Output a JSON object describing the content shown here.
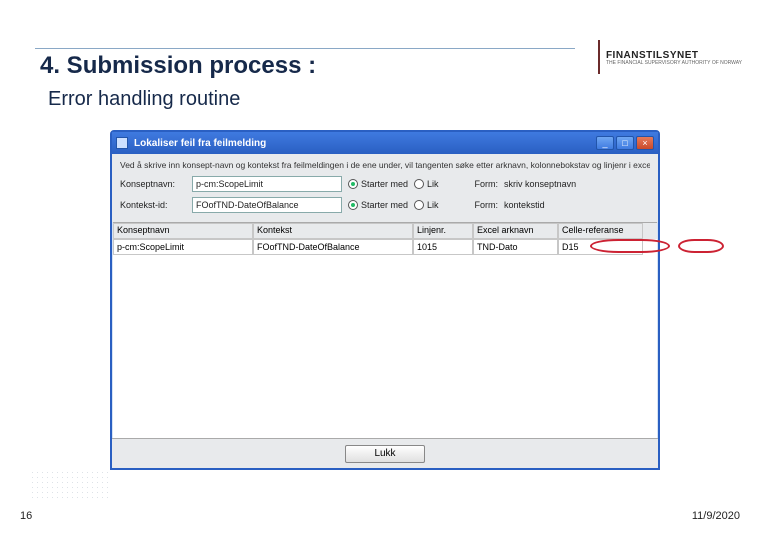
{
  "slide": {
    "title": "4. Submission process :",
    "subtitle": "Error handling routine",
    "page_number": "16",
    "date": "11/9/2020"
  },
  "logo": {
    "name": "FINANSTILSYNET",
    "tagline": "THE FINANCIAL SUPERVISORY AUTHORITY OF NORWAY"
  },
  "window": {
    "title": "Lokaliser feil fra feilmelding",
    "hint": "Ved å skrive inn konsept-navn og kontekst fra feilmeldingen i de ene under, vil tangenten søke etter arknavn, kolonnebokstav og linjenr i excel",
    "rows": [
      {
        "label": "Konseptnavn:",
        "value": "p-cm:ScopeLimit",
        "radio1": "Starter med",
        "radio2": "Lik",
        "form_label": "Form:",
        "form_hint": "skriv konseptnavn"
      },
      {
        "label": "Kontekst-id:",
        "value": "FOofTND-DateOfBalance",
        "radio1": "Starter med",
        "radio2": "Lik",
        "form_label": "Form:",
        "form_hint": "kontekstid"
      }
    ],
    "table": {
      "headers": [
        "Konseptnavn",
        "Kontekst",
        "Linjenr.",
        "Excel arknavn",
        "Celle-referanse"
      ],
      "row": [
        "p-cm:ScopeLimit",
        "FOofTND-DateOfBalance",
        "1015",
        "TND-Dato",
        "D15"
      ]
    },
    "button": "Lukk"
  }
}
